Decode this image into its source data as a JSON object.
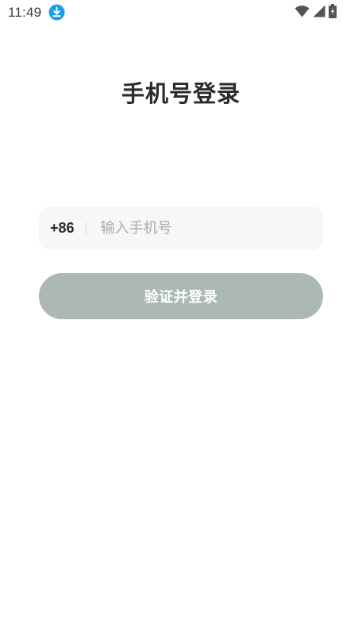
{
  "status_bar": {
    "time": "11:49",
    "icons": [
      "download-icon",
      "wifi-icon",
      "signal-icon",
      "battery-icon"
    ],
    "download_icon_color": "#1a9fe8"
  },
  "login": {
    "title": "手机号登录",
    "country_code": "+86",
    "phone_placeholder": "输入手机号",
    "phone_value": "",
    "submit_label": "验证并登录",
    "submit_color": "#acb9b2",
    "field_background": "#f6f7f6"
  }
}
